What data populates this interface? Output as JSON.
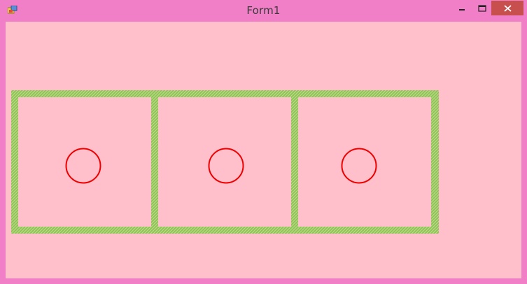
{
  "window": {
    "title": "Form1",
    "background_color": "#f07fc8",
    "client_background": "#ffc0cb"
  },
  "controls": {
    "minimize_icon": "minimize-icon",
    "maximize_icon": "maximize-icon",
    "close_icon": "close-icon",
    "close_color": "#c7504f"
  },
  "panels": [
    {
      "name": "panel-1",
      "circle_color": "#ee0000",
      "border_color": "#8fc35a"
    },
    {
      "name": "panel-2",
      "circle_color": "#ee0000",
      "border_color": "#8fc35a"
    },
    {
      "name": "panel-3",
      "circle_color": "#ee0000",
      "border_color": "#8fc35a"
    }
  ]
}
